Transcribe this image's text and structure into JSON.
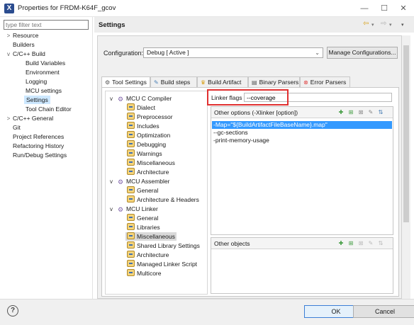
{
  "window": {
    "title": "Properties for FRDM-K64F_gcov",
    "app_icon": "X",
    "minimize": "—",
    "maximize": "☐",
    "close": "✕"
  },
  "sidebar": {
    "filter_placeholder": "type filter text",
    "items": [
      {
        "label": "Resource",
        "arrow": ">"
      },
      {
        "label": "Builders",
        "arrow": ""
      },
      {
        "label": "C/C++ Build",
        "arrow": "v"
      },
      {
        "label": "Build Variables",
        "arrow": ""
      },
      {
        "label": "Environment",
        "arrow": ""
      },
      {
        "label": "Logging",
        "arrow": ""
      },
      {
        "label": "MCU settings",
        "arrow": ""
      },
      {
        "label": "Settings",
        "arrow": ""
      },
      {
        "label": "Tool Chain Editor",
        "arrow": ""
      },
      {
        "label": "C/C++ General",
        "arrow": ">"
      },
      {
        "label": "Git",
        "arrow": ""
      },
      {
        "label": "Project References",
        "arrow": ""
      },
      {
        "label": "Refactoring History",
        "arrow": ""
      },
      {
        "label": "Run/Debug Settings",
        "arrow": ""
      }
    ]
  },
  "header": {
    "title": "Settings",
    "back": "⇦",
    "forward": "⇨",
    "menu": "▾"
  },
  "configuration": {
    "label": "Configuration:",
    "value": "Debug  [ Active ]",
    "manage_label": "Manage Configurations..."
  },
  "tabs": [
    {
      "label": "Tool Settings",
      "icon": "tool-settings-icon"
    },
    {
      "label": "Build steps",
      "icon": "build-steps-icon"
    },
    {
      "label": "Build Artifact",
      "icon": "build-artifact-icon"
    },
    {
      "label": "Binary Parsers",
      "icon": "binary-parsers-icon"
    },
    {
      "label": "Error Parsers",
      "icon": "error-parsers-icon"
    }
  ],
  "tool_tree": {
    "groups": [
      {
        "label": "MCU C Compiler",
        "children": [
          "Dialect",
          "Preprocessor",
          "Includes",
          "Optimization",
          "Debugging",
          "Warnings",
          "Miscellaneous",
          "Architecture"
        ]
      },
      {
        "label": "MCU Assembler",
        "children": [
          "General",
          "Architecture & Headers"
        ]
      },
      {
        "label": "MCU Linker",
        "children": [
          "General",
          "Libraries",
          "Miscellaneous",
          "Shared Library Settings",
          "Architecture",
          "Managed Linker Script",
          "Multicore"
        ]
      }
    ],
    "selected": "Miscellaneous"
  },
  "linker": {
    "flags_label": "Linker flags",
    "flags_value": "--coverage"
  },
  "other_options": {
    "title": "Other options (-Xlinker [option])",
    "items": [
      "-Map=\"${BuildArtifactFileBaseName}.map\"",
      "--gc-sections",
      "-print-memory-usage"
    ]
  },
  "other_objects": {
    "title": "Other objects"
  },
  "footer": {
    "help": "?",
    "ok_label": "OK",
    "cancel_label": "Cancel"
  }
}
